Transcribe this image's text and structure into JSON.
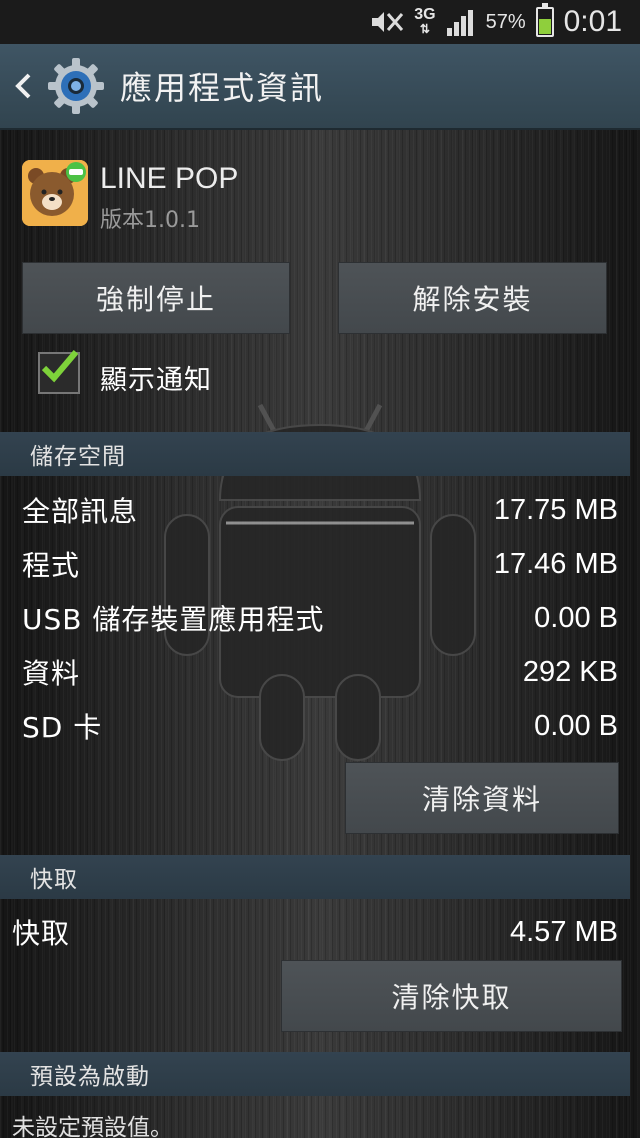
{
  "status_bar": {
    "network": "3G",
    "battery_percent": "57%",
    "time": "0:01",
    "icons": [
      "mute-icon",
      "network-3g-icon",
      "signal-icon",
      "battery-icon"
    ],
    "battery_color": "#8fcf3c"
  },
  "action_bar": {
    "title": "應用程式資訊",
    "icons": [
      "back-icon",
      "settings-gear-icon"
    ],
    "accent": "#3f5564"
  },
  "app": {
    "name": "LINE POP",
    "version": "版本1.0.1",
    "icon": "line-pop-bear-icon"
  },
  "actions": {
    "force_stop": "強制停止",
    "uninstall": "解除安裝"
  },
  "notifications": {
    "label": "顯示通知",
    "checked": true
  },
  "storage": {
    "header": "儲存空間",
    "rows": [
      {
        "label": "全部訊息",
        "value": "17.75 MB"
      },
      {
        "label": "程式",
        "value": "17.46 MB"
      },
      {
        "label": "USB 儲存裝置應用程式",
        "value": "0.00 B"
      },
      {
        "label": "資料",
        "value": "292 KB"
      },
      {
        "label": "SD 卡",
        "value": "0.00 B"
      }
    ],
    "clear_data": "清除資料"
  },
  "cache": {
    "header": "快取",
    "label": "快取",
    "value": "4.57 MB",
    "clear_cache": "清除快取"
  },
  "launch_default": {
    "header": "預設為啟動",
    "text": "未設定預設值。"
  }
}
